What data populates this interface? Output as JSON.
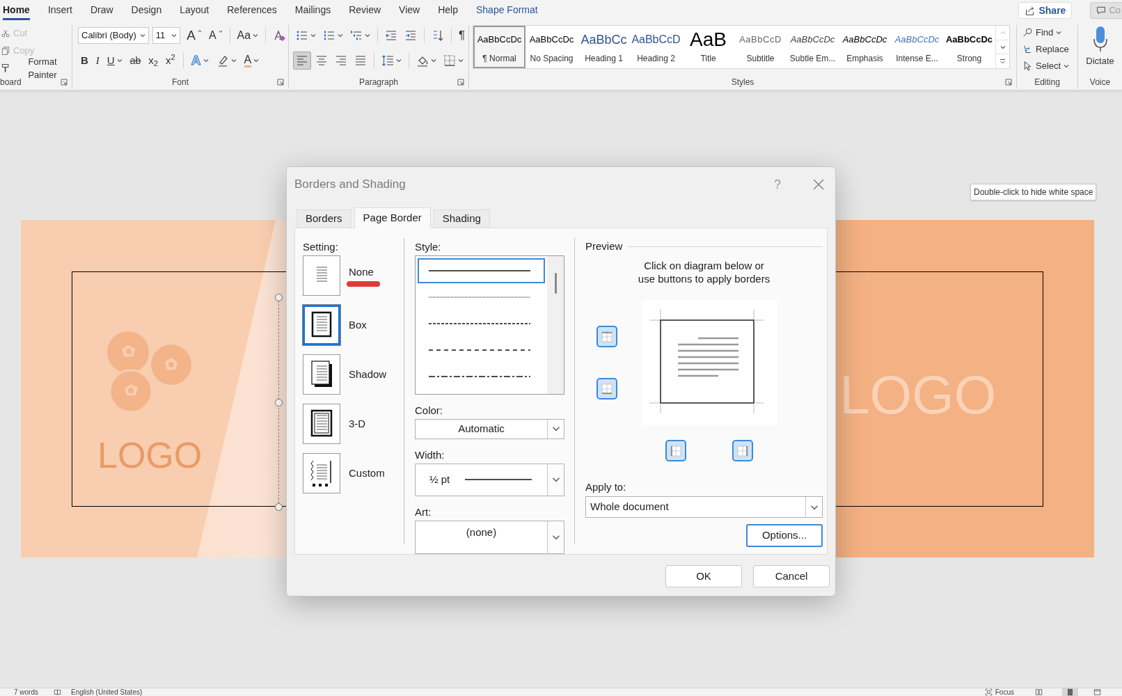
{
  "ribbon_tabs": [
    {
      "label": "Home",
      "selected": true,
      "kind": "standard"
    },
    {
      "label": "Insert",
      "selected": false,
      "kind": "standard"
    },
    {
      "label": "Draw",
      "selected": false,
      "kind": "standard"
    },
    {
      "label": "Design",
      "selected": false,
      "kind": "standard"
    },
    {
      "label": "Layout",
      "selected": false,
      "kind": "standard"
    },
    {
      "label": "References",
      "selected": false,
      "kind": "standard"
    },
    {
      "label": "Mailings",
      "selected": false,
      "kind": "standard"
    },
    {
      "label": "Review",
      "selected": false,
      "kind": "standard"
    },
    {
      "label": "View",
      "selected": false,
      "kind": "standard"
    },
    {
      "label": "Help",
      "selected": false,
      "kind": "standard"
    },
    {
      "label": "Shape Format",
      "selected": false,
      "kind": "contextual"
    }
  ],
  "share_button": {
    "label": "Share"
  },
  "comments_button": {
    "label": "Co"
  },
  "clipboard": {
    "label": "board",
    "items": [
      {
        "label": "Cut",
        "kind": "cut",
        "disabled": true
      },
      {
        "label": "Copy",
        "kind": "copy",
        "disabled": true
      },
      {
        "label": "Format Painter",
        "kind": "painter",
        "disabled": false
      }
    ]
  },
  "font": {
    "label": "Font",
    "font_name": "Calibri (Body)",
    "font_size": "11",
    "row1": [
      [
        {
          "kind": "grow",
          "glyph": "A",
          "caret": false
        },
        {
          "kind": "shrink",
          "glyph": "A",
          "caret": false
        }
      ],
      [
        {
          "kind": "case",
          "glyph": "Aa",
          "caret": true
        }
      ],
      [
        {
          "kind": "clear",
          "caret": false
        }
      ]
    ],
    "row2": [
      [
        {
          "kind": "bold",
          "glyph": "B",
          "caret": false
        },
        {
          "kind": "italic",
          "glyph": "I",
          "caret": false
        },
        {
          "kind": "underline",
          "glyph": "U",
          "caret": true
        },
        {
          "kind": "strike",
          "glyph": "ab",
          "caret": false
        },
        {
          "kind": "subscript",
          "glyph": "x$_{2}$",
          "caret": false
        },
        {
          "kind": "superscript",
          "glyph": "x$^{2}$",
          "caret": false
        }
      ],
      [
        {
          "kind": "effects",
          "glyph": "A",
          "caret": true
        },
        {
          "kind": "highlight",
          "caret": true
        },
        {
          "kind": "fontcolor",
          "glyph": "A",
          "caret": true
        }
      ]
    ]
  },
  "paragraph": {
    "label": "Paragraph",
    "row1": [
      [
        {
          "kind": "bullets",
          "caret": true,
          "selected": false
        },
        {
          "kind": "numbering",
          "caret": true,
          "selected": false
        },
        {
          "kind": "multilevel",
          "caret": true,
          "selected": false
        }
      ],
      [
        {
          "kind": "outdent",
          "caret": false,
          "selected": false
        },
        {
          "kind": "indent",
          "caret": false,
          "selected": false
        }
      ],
      [
        {
          "kind": "sort",
          "caret": false,
          "selected": false
        }
      ],
      [
        {
          "kind": "pilcrow",
          "glyph": "¶",
          "caret": false,
          "selected": false
        }
      ]
    ],
    "row2": [
      [
        {
          "kind": "align-left",
          "caret": false,
          "selected": true
        },
        {
          "kind": "align-center",
          "caret": false,
          "selected": false
        },
        {
          "kind": "align-right",
          "caret": false,
          "selected": false
        },
        {
          "kind": "justify",
          "caret": false,
          "selected": false
        }
      ],
      [
        {
          "kind": "line-spacing",
          "caret": true,
          "selected": false
        }
      ],
      [
        {
          "kind": "shading",
          "caret": true,
          "selected": false
        },
        {
          "kind": "borders",
          "caret": true,
          "selected": false
        }
      ]
    ]
  },
  "styles": {
    "label": "Styles",
    "items": [
      {
        "preview": "AaBbCcDc",
        "name": "¶ Normal",
        "kind": "normal",
        "selected": true
      },
      {
        "preview": "AaBbCcDc",
        "name": "No Spacing",
        "kind": "normal",
        "selected": false
      },
      {
        "preview": "AaBbCc",
        "name": "Heading 1",
        "kind": "heading1",
        "selected": false
      },
      {
        "preview": "AaBbCcD",
        "name": "Heading 2",
        "kind": "heading2",
        "selected": false
      },
      {
        "preview": "AaB",
        "name": "Title",
        "kind": "title",
        "selected": false
      },
      {
        "preview": "AaBbCcD",
        "name": "Subtitle",
        "kind": "subtitle",
        "selected": false
      },
      {
        "preview": "AaBbCcDc",
        "name": "Subtle Em...",
        "kind": "subtle",
        "selected": false
      },
      {
        "preview": "AaBbCcDc",
        "name": "Emphasis",
        "kind": "emphasis",
        "selected": false
      },
      {
        "preview": "AaBbCcDc",
        "name": "Intense E...",
        "kind": "intense",
        "selected": false
      },
      {
        "preview": "AaBbCcDc",
        "name": "Strong",
        "kind": "strong",
        "selected": false
      }
    ]
  },
  "editing": {
    "label": "Editing",
    "items": [
      {
        "label": "Find",
        "kind": "find",
        "caret": true
      },
      {
        "label": "Replace",
        "kind": "replace",
        "caret": false
      },
      {
        "label": "Select",
        "kind": "select",
        "caret": true
      }
    ]
  },
  "voice": {
    "label": "Voice",
    "button": "Dictate"
  },
  "document": {
    "left_logo": "LOGO",
    "right_logo": "LOGO"
  },
  "tooltip": "Double-click to hide white space",
  "dialog": {
    "title": "Borders and Shading",
    "help": "?",
    "tabs": [
      {
        "label": "Borders",
        "selected": false
      },
      {
        "label": "Page Border",
        "selected": true
      },
      {
        "label": "Shading",
        "selected": false
      }
    ],
    "setting": {
      "label": "Setting:",
      "items": [
        {
          "label": "None",
          "kind": "none",
          "selected": false,
          "highlighted": true
        },
        {
          "label": "Box",
          "kind": "box",
          "selected": true,
          "highlighted": false
        },
        {
          "label": "Shadow",
          "kind": "shadow",
          "selected": false,
          "highlighted": false
        },
        {
          "label": "3-D",
          "kind": "double",
          "selected": false,
          "highlighted": false
        },
        {
          "label": "Custom",
          "kind": "custom",
          "selected": false,
          "highlighted": false
        }
      ]
    },
    "style": {
      "label": "Style:",
      "items": [
        {
          "kind": "solid",
          "selected": true
        },
        {
          "kind": "dotted",
          "selected": false
        },
        {
          "kind": "dashed",
          "selected": false
        },
        {
          "kind": "long-dash",
          "selected": false
        },
        {
          "kind": "dash-dot",
          "selected": false
        }
      ]
    },
    "color": {
      "label": "Color:",
      "value": "Automatic"
    },
    "width": {
      "label": "Width:",
      "value": "½ pt"
    },
    "art": {
      "label": "Art:",
      "value": "(none)"
    },
    "preview": {
      "label": "Preview",
      "hint": "Click on diagram below or\nuse buttons to apply borders",
      "side_buttons": [
        {
          "kind": "top"
        },
        {
          "kind": "bottom"
        }
      ],
      "bottom_buttons": [
        {
          "kind": "left"
        },
        {
          "kind": "right"
        }
      ]
    },
    "apply_to": {
      "label": "Apply to:",
      "value": "Whole document"
    },
    "options_button": "Options...",
    "ok_button": "OK",
    "cancel_button": "Cancel"
  },
  "status_bar": {
    "words": "7 words",
    "language": "English (United States)",
    "focus": "Focus"
  }
}
